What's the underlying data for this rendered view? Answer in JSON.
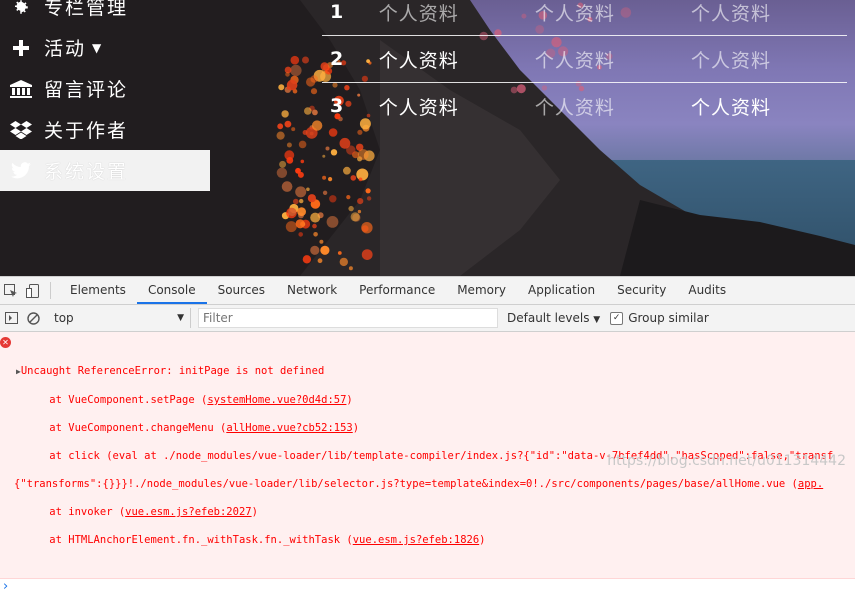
{
  "sidebar": {
    "items": [
      {
        "label": "专栏管理",
        "icon": "gear-icon"
      },
      {
        "label": "活动",
        "icon": "plus-icon",
        "has_caret": true
      },
      {
        "label": "留言评论",
        "icon": "bank-icon"
      },
      {
        "label": "关于作者",
        "icon": "dropbox-icon"
      },
      {
        "label": "系统设置",
        "icon": "twitter-icon",
        "active": true
      }
    ]
  },
  "profile_table": {
    "rows": [
      {
        "num": "1",
        "cells": [
          "个人资料",
          "个人资料",
          "个人资料"
        ]
      },
      {
        "num": "2",
        "cells": [
          "个人资料",
          "个人资料",
          "个人资料"
        ]
      },
      {
        "num": "3",
        "cells": [
          "个人资料",
          "个人资料",
          "个人资料"
        ]
      }
    ]
  },
  "devtools": {
    "tabs": [
      "Elements",
      "Console",
      "Sources",
      "Network",
      "Performance",
      "Memory",
      "Application",
      "Security",
      "Audits"
    ],
    "active_tab": "Console",
    "context": "top",
    "filter_placeholder": "Filter",
    "levels": "Default levels",
    "group_similar": "Group similar",
    "group_similar_checked": true
  },
  "console": {
    "error_lines": [
      "Uncaught ReferenceError: initPage is not defined",
      "at VueComponent.setPage (",
      "systemHome.vue?0d4d:57",
      ")",
      "at VueComponent.changeMenu (",
      "allHome.vue?cb52:153",
      ")",
      "at click (eval at ./node_modules/vue-loader/lib/template-compiler/index.js?{\"id\":\"data-v-7bfef4dd\",\"hasScoped\":false,\"transf",
      "{\"transforms\":{}}}!./node_modules/vue-loader/lib/selector.js?type=template&index=0!./src/components/pages/base/allHome.vue (",
      "app.",
      "at invoker (",
      "vue.esm.js?efeb:2027",
      ")",
      "at HTMLAnchorElement.fn._withTask.fn._withTask (",
      "vue.esm.js?efeb:1826",
      ")"
    ]
  },
  "watermark": "https://blog.csdn.net/u011314442",
  "colors": {
    "error_red": "#ff0000",
    "error_bg": "#fff0f0",
    "accent_blue": "#1a73e8"
  }
}
